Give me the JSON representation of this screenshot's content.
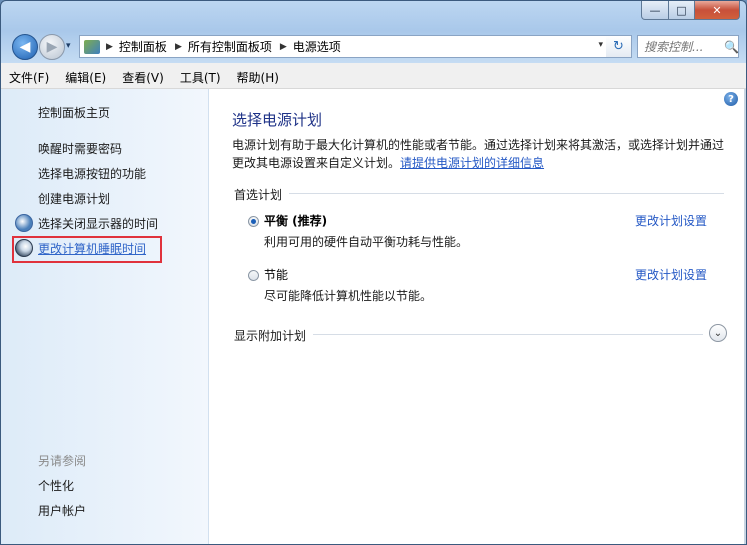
{
  "window": {
    "caption_min": "—",
    "caption_max": "□",
    "caption_close": "✕"
  },
  "nav": {
    "back_glyph": "◀",
    "forward_glyph": "▶",
    "history_glyph": "▾"
  },
  "address": {
    "separator": "▶",
    "crumbs": [
      "控制面板",
      "所有控制面板项",
      "电源选项"
    ],
    "dropdown_glyph": "▾",
    "refresh_glyph": "↻"
  },
  "search": {
    "placeholder": "搜索控制...",
    "glyph": "🔍"
  },
  "menu": {
    "items": [
      "文件(F)",
      "编辑(E)",
      "查看(V)",
      "工具(T)",
      "帮助(H)"
    ]
  },
  "sidebar": {
    "home": "控制面板主页",
    "items": [
      "唤醒时需要密码",
      "选择电源按钮的功能",
      "创建电源计划",
      "选择关闭显示器的时间",
      "更改计算机睡眠时间"
    ],
    "see_also_label": "另请参阅",
    "see_also": [
      "个性化",
      "用户帐户"
    ]
  },
  "main": {
    "help": "?",
    "title": "选择电源计划",
    "desc": "电源计划有助于最大化计算机的性能或者节能。通过选择计划来将其激活，或选择计划并通过更改其电源设置来自定义计划。",
    "desc_link": "请提供电源计划的详细信息",
    "preferred_label": "首选计划",
    "plans": [
      {
        "name": "平衡 (推荐)",
        "desc": "利用可用的硬件自动平衡功耗与性能。",
        "link": "更改计划设置",
        "selected": true
      },
      {
        "name": "节能",
        "desc": "尽可能降低计算机性能以节能。",
        "link": "更改计划设置",
        "selected": false
      }
    ],
    "more_plans_label": "显示附加计划",
    "expand_glyph": "⌄"
  }
}
